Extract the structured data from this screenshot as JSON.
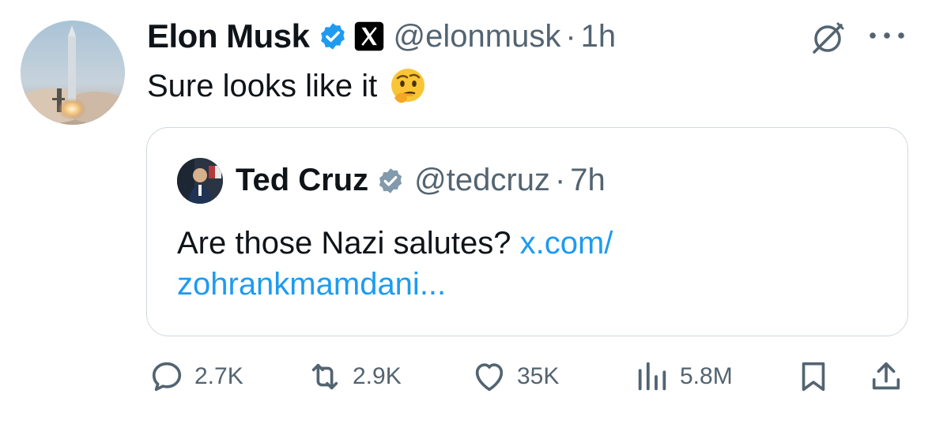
{
  "tweet": {
    "author_name": "Elon Musk",
    "author_handle": "@elonmusk",
    "separator": "·",
    "time": "1h",
    "text": "Sure looks like it",
    "emoji_icon": "thinking-face-emoji"
  },
  "quoted": {
    "author_name": "Ted Cruz",
    "author_handle": "@tedcruz",
    "separator": "·",
    "time": "7h",
    "text": "Are those Nazi salutes?",
    "link_line1": "x.com/",
    "link_line2": "zohrankmamdani..."
  },
  "actions": {
    "replies": "2.7K",
    "reposts": "2.9K",
    "likes": "35K",
    "views": "5.8M"
  },
  "colors": {
    "verified": "#1d9bf0",
    "quote_verified": "#829aab",
    "muted_text": "#536471",
    "link": "#1d9bf0",
    "border": "#cfd9de"
  }
}
